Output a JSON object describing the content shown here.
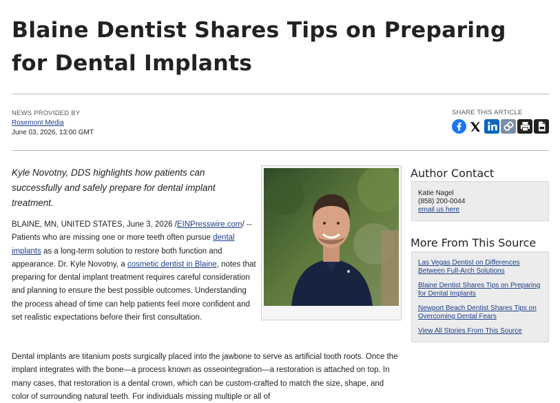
{
  "headline": "Blaine Dentist Shares Tips on Preparing for Dental Implants",
  "byline": {
    "caption": "NEWS PROVIDED BY",
    "source": "Rosemont Media",
    "date": "June 03, 2026, 13:00 GMT"
  },
  "share": {
    "caption": "SHARE THIS ARTICLE",
    "icons": [
      "facebook-icon",
      "x-icon",
      "linkedin-icon",
      "copy-link-icon",
      "print-icon",
      "pdf-icon"
    ],
    "colors": {
      "facebook": "#1877f2",
      "x": "#111111",
      "linkedin": "#0a66c2",
      "copy": "#7a8fa6",
      "print": "#222222",
      "pdf": "#222222"
    }
  },
  "article": {
    "lede": "Kyle Novotny, DDS highlights how patients can successfully and safely prepare for dental implant treatment.",
    "p1": {
      "dateline": "BLAINE, MN, UNITED STATES, June 3, 2026 /",
      "dateline_link": "EINPresswire.com",
      "dateline_end": "/ -- Patients who are missing one or more teeth often pursue ",
      "link1": "dental implants",
      "text2": " as a long-term solution to restore both function and appearance. Dr. Kyle Novotny, a ",
      "link2": "cosmetic dentist in Blaine",
      "text3": ", notes that preparing for dental implant treatment requires careful consideration and planning to ensure the best possible outcomes. Understanding the process ahead of time can help patients feel more confident and set realistic expectations before their first consultation."
    },
    "p2": "Dental implants are titanium posts surgically placed into the jawbone to serve as artificial tooth roots. Once the implant integrates with the bone—a process known as osseointegration—a restoration is attached on top. In many cases, that restoration is a dental crown, which can be custom-crafted to match the size, shape, and color of surrounding natural teeth. For individuals missing multiple or all of"
  },
  "author_contact": {
    "title": "Author Contact",
    "name": "Katie Nagel",
    "phone": "(858) 200-0044",
    "email_label": "email us here"
  },
  "more_from_source": {
    "title": "More From This Source",
    "links": [
      "Las Vegas Dentist on Differences Between Full-Arch Solutions",
      "Blaine Dentist Shares Tips on Preparing for Dental Implants",
      "Newport Beach Dentist Shares Tips on Overcoming Dental Fears",
      "View All Stories From This Source"
    ]
  }
}
